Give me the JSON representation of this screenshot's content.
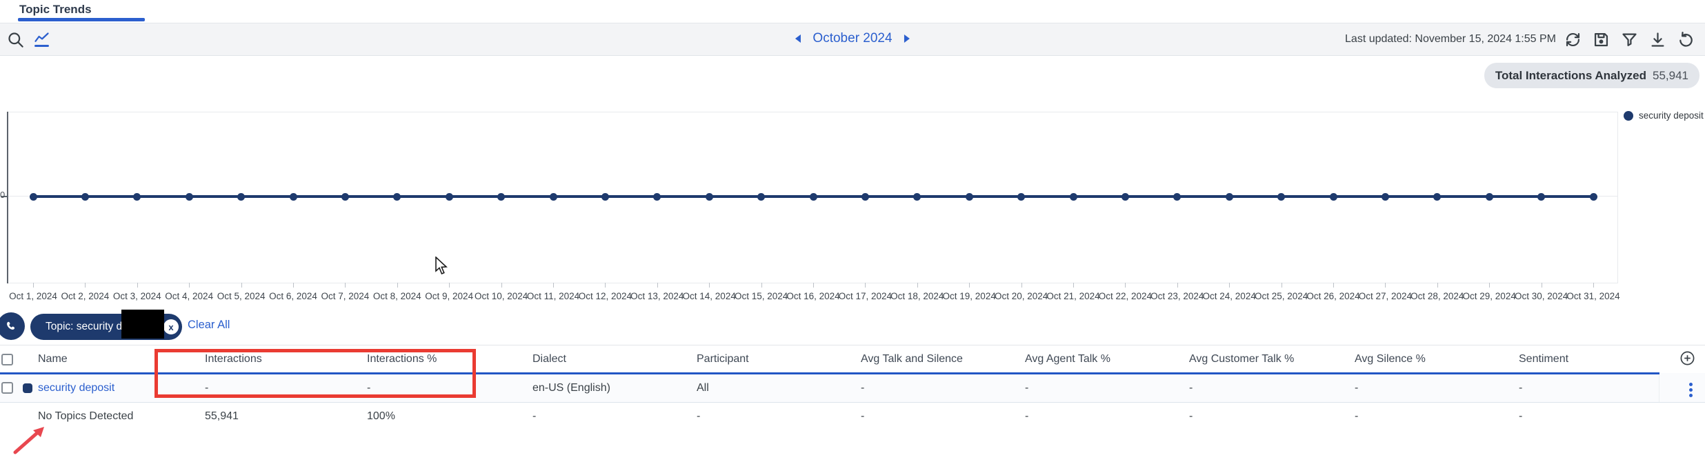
{
  "tab_bar": {
    "active_tab": "Topic Trends"
  },
  "toolbar": {
    "date_nav": {
      "label": "October 2024"
    },
    "last_updated": "Last updated: November 15, 2024 1:55 PM",
    "icons": [
      "search-icon",
      "chart-view-icon",
      "refresh-icon",
      "save-icon",
      "filter-icon",
      "download-icon",
      "undo-icon"
    ]
  },
  "summary_badge": {
    "label": "Total Interactions Analyzed",
    "value": "55,941"
  },
  "chart_data": {
    "type": "line",
    "x": [
      "Oct 1, 2024",
      "Oct 2, 2024",
      "Oct 3, 2024",
      "Oct 4, 2024",
      "Oct 5, 2024",
      "Oct 6, 2024",
      "Oct 7, 2024",
      "Oct 8, 2024",
      "Oct 9, 2024",
      "Oct 10, 2024",
      "Oct 11, 2024",
      "Oct 12, 2024",
      "Oct 13, 2024",
      "Oct 14, 2024",
      "Oct 15, 2024",
      "Oct 16, 2024",
      "Oct 17, 2024",
      "Oct 18, 2024",
      "Oct 19, 2024",
      "Oct 20, 2024",
      "Oct 21, 2024",
      "Oct 22, 2024",
      "Oct 23, 2024",
      "Oct 24, 2024",
      "Oct 25, 2024",
      "Oct 26, 2024",
      "Oct 27, 2024",
      "Oct 28, 2024",
      "Oct 29, 2024",
      "Oct 30, 2024",
      "Oct 31, 2024"
    ],
    "series": [
      {
        "name": "security deposit",
        "values": [
          0,
          0,
          0,
          0,
          0,
          0,
          0,
          0,
          0,
          0,
          0,
          0,
          0,
          0,
          0,
          0,
          0,
          0,
          0,
          0,
          0,
          0,
          0,
          0,
          0,
          0,
          0,
          0,
          0,
          0,
          0
        ]
      }
    ],
    "y_ticks": [
      "0"
    ],
    "legend_position": "top-right",
    "grid": "single horizontal gridline at series level",
    "line_color": "#1e3a6d"
  },
  "filter_bar": {
    "chip_label": "Topic: security d",
    "chip_remove": "x",
    "clear_all": "Clear All",
    "phone_icon": "phone-icon"
  },
  "table": {
    "columns": [
      "Name",
      "Interactions",
      "Interactions %",
      "Dialect",
      "Participant",
      "Avg Talk and Silence",
      "Avg Agent Talk %",
      "Avg Customer Talk %",
      "Avg Silence %",
      "Sentiment"
    ],
    "rows": [
      {
        "name": "security deposit",
        "is_link": true,
        "has_checkbox": true,
        "has_marker": true,
        "has_menu": true,
        "cells": [
          "-",
          "-",
          "en-US (English)",
          "All",
          "-",
          "-",
          "-",
          "-",
          "-"
        ]
      },
      {
        "name": "No Topics Detected",
        "is_link": false,
        "has_checkbox": false,
        "has_marker": false,
        "has_menu": false,
        "cells": [
          "55,941",
          "100%",
          "-",
          "-",
          "-",
          "-",
          "-",
          "-",
          "-"
        ]
      }
    ]
  },
  "colors": {
    "accent_blue": "#2b5fce",
    "navy": "#1e3a6d",
    "annotation_red": "#ea3b32",
    "header_underline": "#2256c4"
  },
  "annotations": {
    "redaction_box": "black box over chip text",
    "highlight_box": "red box around Interactions / Interactions % columns",
    "arrow_target": "No Topics Detected"
  }
}
